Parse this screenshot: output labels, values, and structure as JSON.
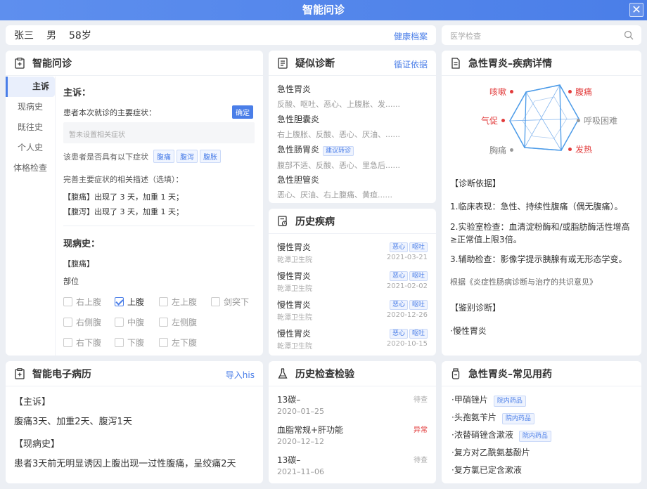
{
  "window": {
    "title": "智能问诊",
    "close": "✕"
  },
  "patient": {
    "name": "张三",
    "gender": "男",
    "age": "58岁",
    "archive_link": "健康档案"
  },
  "search": {
    "placeholder": "医学检查"
  },
  "inquiry": {
    "title": "智能问诊",
    "nav": [
      "主诉",
      "现病史",
      "既往史",
      "个人史",
      "体格检查"
    ],
    "chief_title": "主诉：",
    "main_symptom_q": "患者本次就诊的主要症状：",
    "confirm": "确定",
    "symptom_placeholder": "暂未设置相关症状",
    "has_symptom_q": "该患者是否具有以下症状",
    "symptom_tags": [
      "腹痛",
      "腹泻",
      "腹胀"
    ],
    "desc_q": "完善主要症状的相关描述（选填）：",
    "desc_lines": [
      "【腹痛】出现了 3 天，加重 1 天；",
      "【腹泻】出现了 3 天，加重 1 天；"
    ],
    "history_title": "现病史：",
    "history_tag": "【腹痛】",
    "site_label": "部位",
    "sites": [
      {
        "label": "右上腹",
        "checked": false
      },
      {
        "label": "上腹",
        "checked": true
      },
      {
        "label": "左上腹",
        "checked": false
      },
      {
        "label": "剑突下",
        "checked": false
      },
      {
        "label": "右侧腹",
        "checked": false
      },
      {
        "label": "中腹",
        "checked": false
      },
      {
        "label": "左侧腹",
        "checked": false
      },
      {
        "label": "右下腹",
        "checked": false
      },
      {
        "label": "下腹",
        "checked": false
      },
      {
        "label": "左下腹",
        "checked": false
      }
    ]
  },
  "diagnosis": {
    "title": "疑似诊断",
    "link": "循证依据",
    "items": [
      {
        "name": "急性胃炎",
        "desc": "反酸、呕吐、恶心、上腹胀、发......",
        "tag": ""
      },
      {
        "name": "急性胆囊炎",
        "desc": "右上腹胀、反酸、恶心、厌油、......",
        "tag": ""
      },
      {
        "name": "急性肠胃炎",
        "desc": "腹部不适、反酸、恶心、里急后......",
        "tag": "建议转诊"
      },
      {
        "name": "急性胆管炎",
        "desc": "恶心、厌油、右上腹痛、黄疸......",
        "tag": ""
      }
    ]
  },
  "history_disease": {
    "title": "历史疾病",
    "items": [
      {
        "name": "慢性胃炎",
        "hospital": "乾潭卫生院",
        "tags": [
          "恶心",
          "呕吐"
        ],
        "date": "2021-03-21"
      },
      {
        "name": "慢性胃炎",
        "hospital": "乾潭卫生院",
        "tags": [
          "恶心",
          "呕吐"
        ],
        "date": "2021-02-02"
      },
      {
        "name": "慢性胃炎",
        "hospital": "乾潭卫生院",
        "tags": [
          "恶心",
          "呕吐"
        ],
        "date": "2020-12-26"
      },
      {
        "name": "慢性胃炎",
        "hospital": "乾潭卫生院",
        "tags": [
          "恶心",
          "呕吐"
        ],
        "date": "2020-10-15"
      }
    ]
  },
  "disease_detail": {
    "title": "急性胃炎–疾病详情",
    "radar": {
      "labels": [
        {
          "text": "咳嗽",
          "color": "#e23b3b"
        },
        {
          "text": "腹痛",
          "color": "#e23b3b"
        },
        {
          "text": "呼吸困难",
          "color": "#888888"
        },
        {
          "text": "发热",
          "color": "#e23b3b"
        },
        {
          "text": "胸痛",
          "color": "#888888"
        },
        {
          "text": "气促",
          "color": "#e23b3b"
        }
      ]
    },
    "basis_title": "【诊断依据】",
    "basis": [
      "1.临床表现：急性、持续性腹痛（偶无腹痛）。",
      "2.实验室检查：血清淀粉酶和/或脂肪酶活性增高≥正常值上限3倍。",
      "3.辅助检查：影像学提示胰腺有或无形态学变。"
    ],
    "reference": "根据《炎症性肠病诊断与治疗的共识意见》",
    "diff_title": "【鉴别诊断】",
    "diff": "·慢性胃炎"
  },
  "emr": {
    "title": "智能电子病历",
    "link": "导入his",
    "chief_title": "【主诉】",
    "chief": "腹痛3天、加重2天、腹泻1天",
    "history_title": "【现病史】",
    "history": "患者3天前无明显诱因上腹出现一过性腹痛，呈绞痛2天"
  },
  "lab_history": {
    "title": "历史检查检验",
    "items": [
      {
        "name": "13碳–",
        "date": "2020–01–25",
        "status": "待查",
        "abnormal": false
      },
      {
        "name": "血脂常规+肝功能",
        "date": "2020–12–12",
        "status": "异常",
        "abnormal": true
      },
      {
        "name": "13碳–",
        "date": "2021–11–06",
        "status": "待查",
        "abnormal": false
      }
    ]
  },
  "medication": {
    "title": "急性胃炎–常见用药",
    "items": [
      {
        "name": "·甲硝锉片",
        "tag": "院内药品"
      },
      {
        "name": "·头孢氨苄片",
        "tag": "院内药品"
      },
      {
        "name": "·浓替硝锉含漱液",
        "tag": "院内药品"
      },
      {
        "name": "·复方对乙酰氨基酚片",
        "tag": ""
      },
      {
        "name": "·复方氯已定含漱液",
        "tag": ""
      }
    ]
  },
  "colors": {
    "accent": "#4a7ee8",
    "alert": "#e23b3b"
  }
}
